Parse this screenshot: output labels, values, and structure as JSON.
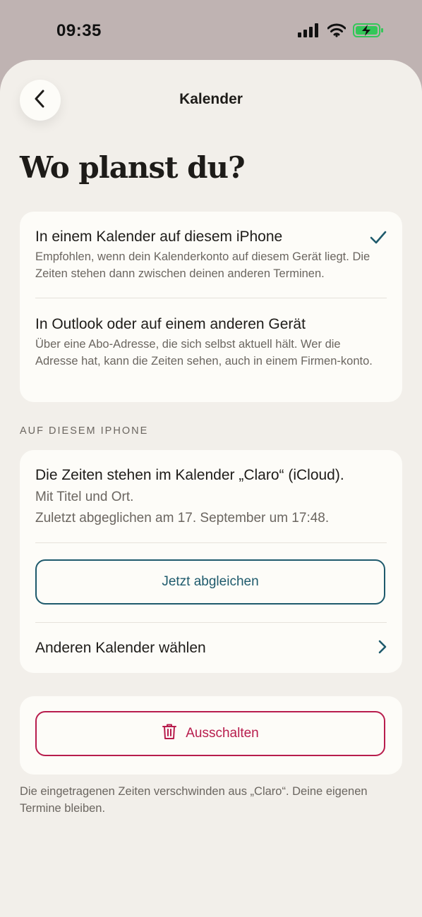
{
  "status_bar": {
    "time": "09:35",
    "icons": [
      "cellular-signal-icon",
      "wifi-icon",
      "battery-charging-icon"
    ]
  },
  "nav": {
    "back_icon": "chevron-left-icon",
    "title": "Kalender"
  },
  "page": {
    "title": "Wo planst du?"
  },
  "options": [
    {
      "title": "In einem Kalender auf diesem iPhone",
      "description": "Empfohlen, wenn dein Kalenderkonto auf diesem Gerät liegt. Die Zeiten stehen dann zwischen deinen anderen Terminen.",
      "selected": true
    },
    {
      "title": "In Outlook oder auf einem anderen Gerät",
      "description": "Über eine Abo-Adresse, die sich selbst aktuell hält. Wer die Adresse hat, kann die Zeiten sehen, auch in einem Firmen-konto.",
      "selected": false
    }
  ],
  "section": {
    "header": "AUF DIESEM IPHONE"
  },
  "calendar_info": {
    "title": "Die Zeiten stehen im Kalender „Claro“ (iCloud).",
    "detail": "Mit Titel und Ort.",
    "last_sync": "Zuletzt abgeglichen am 17. September um 17:48.",
    "sync_button": "Jetzt abgleichen",
    "choose_other": "Anderen Kalender wählen"
  },
  "disable": {
    "button": "Ausschalten",
    "icon": "trash-icon",
    "note": "Die eingetragenen Zeiten verschwinden aus „Claro“. Deine eigenen Termine bleiben."
  },
  "colors": {
    "background": "#bfb3b2",
    "sheet": "#f2efea",
    "card": "#fdfcf8",
    "accent_teal": "#1e5a6c",
    "destructive": "#b81d4d",
    "battery_green": "#34c759"
  }
}
